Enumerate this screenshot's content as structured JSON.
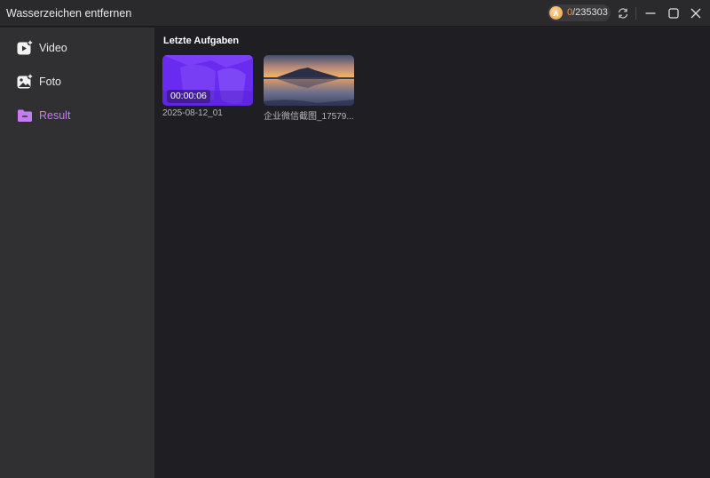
{
  "window": {
    "title": "Wasserzeichen entfernen"
  },
  "credits": {
    "used": "0",
    "total": "/235303"
  },
  "titlebar_icons": [
    "coin-icon",
    "refresh-icon",
    "minimize-icon",
    "maximize-icon",
    "close-icon"
  ],
  "sidebar": {
    "items": [
      {
        "label": "Video",
        "icon": "video-add-icon",
        "active": false
      },
      {
        "label": "Foto",
        "icon": "photo-add-icon",
        "active": false
      },
      {
        "label": "Result",
        "icon": "folder-icon",
        "active": true
      }
    ]
  },
  "colors": {
    "accent": "#c77bf0",
    "sidebar_bg": "#303032",
    "main_bg": "#1f1e22",
    "video_thumb": "#6a2bf0"
  },
  "main": {
    "section_title": "Letzte Aufgaben",
    "tasks": [
      {
        "caption": "2025-08-12_01",
        "duration": "00:00:06",
        "type": "video"
      },
      {
        "caption": "企业微信截图_17579...",
        "type": "image"
      }
    ]
  }
}
